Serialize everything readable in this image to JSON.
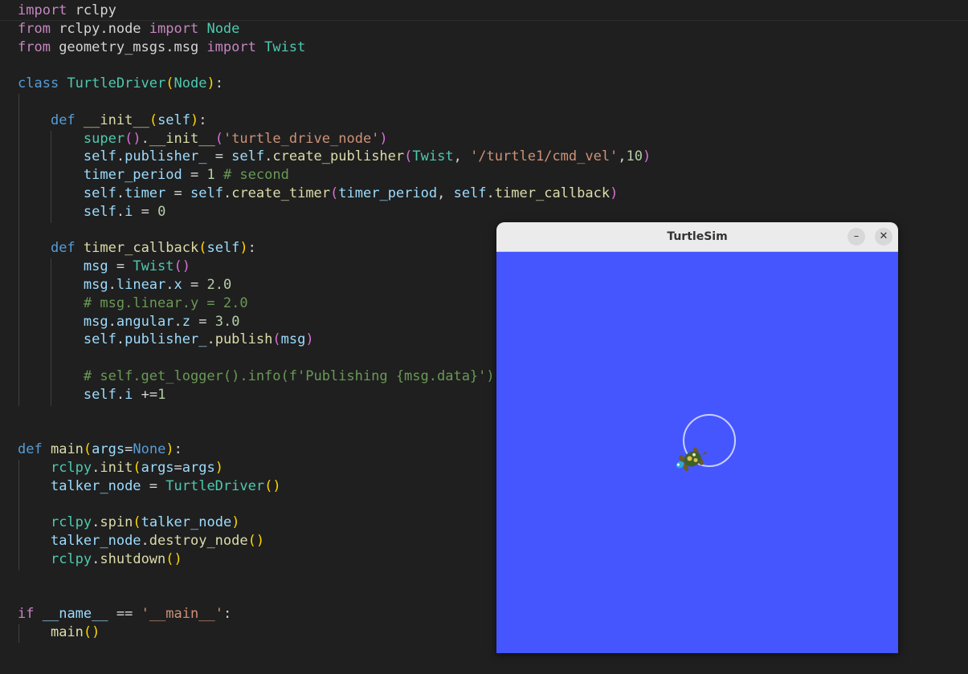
{
  "editor": {
    "lines": [
      [
        [
          "import",
          "kw"
        ],
        [
          " rclpy",
          ""
        ]
      ],
      [
        [
          "from",
          "kw"
        ],
        [
          " rclpy.node ",
          ""
        ],
        [
          "import",
          "kw"
        ],
        [
          " ",
          ""
        ],
        [
          "Node",
          "cls"
        ]
      ],
      [
        [
          "from",
          "kw"
        ],
        [
          " geometry_msgs.msg ",
          ""
        ],
        [
          "import",
          "kw"
        ],
        [
          " ",
          ""
        ],
        [
          "Twist",
          "cls"
        ]
      ],
      [],
      [
        [
          "class",
          "st"
        ],
        [
          " ",
          ""
        ],
        [
          "TurtleDriver",
          "cls"
        ],
        [
          "(",
          "p1"
        ],
        [
          "Node",
          "cls"
        ],
        [
          ")",
          "p1"
        ],
        [
          ":",
          ""
        ]
      ],
      [],
      [
        [
          "    ",
          ""
        ],
        [
          "def",
          "st"
        ],
        [
          " ",
          ""
        ],
        [
          "__init__",
          "fn"
        ],
        [
          "(",
          "p1"
        ],
        [
          "self",
          "var"
        ],
        [
          ")",
          "p1"
        ],
        [
          ":",
          ""
        ]
      ],
      [
        [
          "        ",
          ""
        ],
        [
          "super",
          "cls"
        ],
        [
          "()",
          "p2"
        ],
        [
          ".",
          ""
        ],
        [
          "__init__",
          "fn"
        ],
        [
          "(",
          "p2"
        ],
        [
          "'turtle_drive_node'",
          "str"
        ],
        [
          ")",
          "p2"
        ]
      ],
      [
        [
          "        ",
          ""
        ],
        [
          "self",
          "var"
        ],
        [
          ".",
          ""
        ],
        [
          "publisher_",
          "var"
        ],
        [
          " = ",
          ""
        ],
        [
          "self",
          "var"
        ],
        [
          ".",
          ""
        ],
        [
          "create_publisher",
          "fn"
        ],
        [
          "(",
          "p2"
        ],
        [
          "Twist",
          "cls"
        ],
        [
          ", ",
          ""
        ],
        [
          "'/turtle1/cmd_vel'",
          "str"
        ],
        [
          ",",
          ""
        ],
        [
          "10",
          "num"
        ],
        [
          ")",
          "p2"
        ]
      ],
      [
        [
          "        ",
          ""
        ],
        [
          "timer_period",
          "var"
        ],
        [
          " = ",
          ""
        ],
        [
          "1",
          "num"
        ],
        [
          " ",
          ""
        ],
        [
          "# second",
          "com"
        ]
      ],
      [
        [
          "        ",
          ""
        ],
        [
          "self",
          "var"
        ],
        [
          ".",
          ""
        ],
        [
          "timer",
          "var"
        ],
        [
          " = ",
          ""
        ],
        [
          "self",
          "var"
        ],
        [
          ".",
          ""
        ],
        [
          "create_timer",
          "fn"
        ],
        [
          "(",
          "p2"
        ],
        [
          "timer_period",
          "var"
        ],
        [
          ", ",
          ""
        ],
        [
          "self",
          "var"
        ],
        [
          ".",
          ""
        ],
        [
          "timer_callback",
          "fn"
        ],
        [
          ")",
          "p2"
        ]
      ],
      [
        [
          "        ",
          ""
        ],
        [
          "self",
          "var"
        ],
        [
          ".",
          ""
        ],
        [
          "i",
          "var"
        ],
        [
          " = ",
          ""
        ],
        [
          "0",
          "num"
        ]
      ],
      [],
      [
        [
          "    ",
          ""
        ],
        [
          "def",
          "st"
        ],
        [
          " ",
          ""
        ],
        [
          "timer_callback",
          "fn"
        ],
        [
          "(",
          "p1"
        ],
        [
          "self",
          "var"
        ],
        [
          ")",
          "p1"
        ],
        [
          ":",
          ""
        ]
      ],
      [
        [
          "        ",
          ""
        ],
        [
          "msg",
          "var"
        ],
        [
          " = ",
          ""
        ],
        [
          "Twist",
          "cls"
        ],
        [
          "()",
          "p2"
        ]
      ],
      [
        [
          "        ",
          ""
        ],
        [
          "msg",
          "var"
        ],
        [
          ".",
          ""
        ],
        [
          "linear",
          "var"
        ],
        [
          ".",
          ""
        ],
        [
          "x",
          "var"
        ],
        [
          " = ",
          ""
        ],
        [
          "2.0",
          "num"
        ]
      ],
      [
        [
          "        ",
          ""
        ],
        [
          "# msg.linear.y = 2.0",
          "com"
        ]
      ],
      [
        [
          "        ",
          ""
        ],
        [
          "msg",
          "var"
        ],
        [
          ".",
          ""
        ],
        [
          "angular",
          "var"
        ],
        [
          ".",
          ""
        ],
        [
          "z",
          "var"
        ],
        [
          " = ",
          ""
        ],
        [
          "3.0",
          "num"
        ]
      ],
      [
        [
          "        ",
          ""
        ],
        [
          "self",
          "var"
        ],
        [
          ".",
          ""
        ],
        [
          "publisher_",
          "var"
        ],
        [
          ".",
          ""
        ],
        [
          "publish",
          "fn"
        ],
        [
          "(",
          "p2"
        ],
        [
          "msg",
          "var"
        ],
        [
          ")",
          "p2"
        ]
      ],
      [],
      [
        [
          "        ",
          ""
        ],
        [
          "# self.get_logger().info(f'Publishing {msg.data}')",
          "com"
        ]
      ],
      [
        [
          "        ",
          ""
        ],
        [
          "self",
          "var"
        ],
        [
          ".",
          ""
        ],
        [
          "i",
          "var"
        ],
        [
          " +=",
          ""
        ],
        [
          "1",
          "num"
        ]
      ],
      [],
      [],
      [
        [
          "def",
          "st"
        ],
        [
          " ",
          ""
        ],
        [
          "main",
          "fn"
        ],
        [
          "(",
          "p1"
        ],
        [
          "args",
          "var"
        ],
        [
          "=",
          ""
        ],
        [
          "None",
          "st"
        ],
        [
          ")",
          "p1"
        ],
        [
          ":",
          ""
        ]
      ],
      [
        [
          "    ",
          ""
        ],
        [
          "rclpy",
          "cls"
        ],
        [
          ".",
          ""
        ],
        [
          "init",
          "fn"
        ],
        [
          "(",
          "p1"
        ],
        [
          "args",
          "var"
        ],
        [
          "=",
          ""
        ],
        [
          "args",
          "var"
        ],
        [
          ")",
          "p1"
        ]
      ],
      [
        [
          "    ",
          ""
        ],
        [
          "talker_node",
          "var"
        ],
        [
          " = ",
          ""
        ],
        [
          "TurtleDriver",
          "cls"
        ],
        [
          "()",
          "p1"
        ]
      ],
      [],
      [
        [
          "    ",
          ""
        ],
        [
          "rclpy",
          "cls"
        ],
        [
          ".",
          ""
        ],
        [
          "spin",
          "fn"
        ],
        [
          "(",
          "p1"
        ],
        [
          "talker_node",
          "var"
        ],
        [
          ")",
          "p1"
        ]
      ],
      [
        [
          "    ",
          ""
        ],
        [
          "talker_node",
          "var"
        ],
        [
          ".",
          ""
        ],
        [
          "destroy_node",
          "fn"
        ],
        [
          "()",
          "p1"
        ]
      ],
      [
        [
          "    ",
          ""
        ],
        [
          "rclpy",
          "cls"
        ],
        [
          ".",
          ""
        ],
        [
          "shutdown",
          "fn"
        ],
        [
          "()",
          "p1"
        ]
      ],
      [],
      [],
      [
        [
          "if",
          "kw"
        ],
        [
          " ",
          ""
        ],
        [
          "__name__",
          "var"
        ],
        [
          " == ",
          ""
        ],
        [
          "'__main__'",
          "str"
        ],
        [
          ":",
          ""
        ]
      ],
      [
        [
          "    ",
          ""
        ],
        [
          "main",
          "fn"
        ],
        [
          "()",
          "p1"
        ]
      ]
    ]
  },
  "turtlesim": {
    "title": "TurtleSim",
    "minimize_glyph": "–",
    "close_glyph": "✕",
    "background_color": "#4556ff",
    "path_color": "#c8d0ff"
  }
}
